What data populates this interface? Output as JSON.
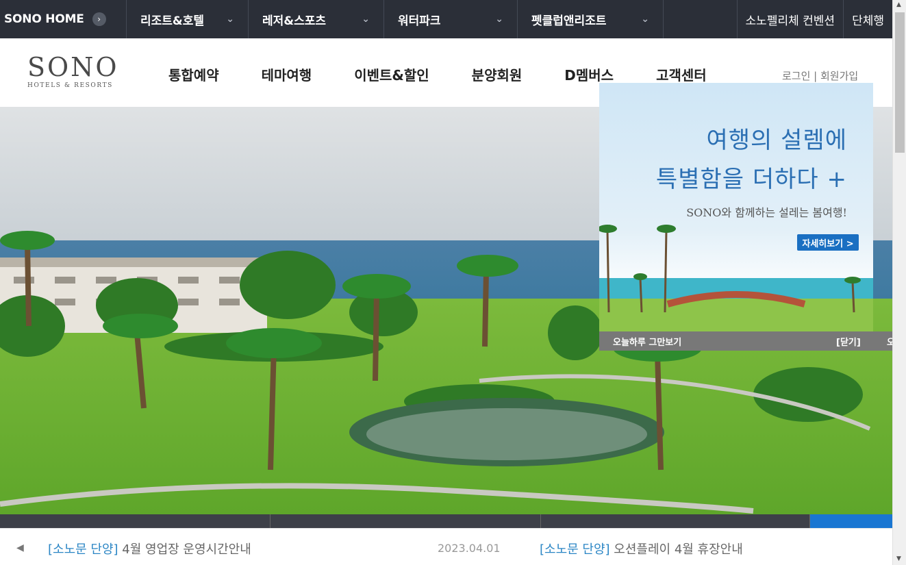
{
  "topbar": {
    "home_label": "SONO HOME",
    "menus": [
      "리조트&호텔",
      "레저&스포츠",
      "워터파크",
      "펫클럽앤리조트"
    ],
    "right_links": [
      "소노펠리체 컨벤션",
      "단체행"
    ]
  },
  "header": {
    "logo_main": "SONO",
    "logo_sub": "HOTELS & RESORTS",
    "nav": [
      "통합예약",
      "테마여행",
      "이벤트&할인",
      "분양회원",
      "D멤버스",
      "고객센터"
    ],
    "login": "로그인 | 회원가입"
  },
  "popup": {
    "line1": "여행의 설렘에",
    "line2": "특별함을 더하다 +",
    "line3": "SONO와 함께하는 설레는 봄여행!",
    "button": "자세히보기 >",
    "close_today": "오늘하루 그만보기",
    "close": "[닫기]",
    "extra": "오"
  },
  "notice": {
    "item1_tag": "[소노문 단양]",
    "item1_text": " 4월 영업장 운영시간안내",
    "date": "2023.04.01",
    "item2_tag": "[소노문 단양]",
    "item2_text": " 오션플레이 4월 휴장안내"
  },
  "colors": {
    "topbar_bg": "#2b2f38",
    "accent_blue": "#1976d2",
    "popup_title": "#2b6fb3"
  }
}
